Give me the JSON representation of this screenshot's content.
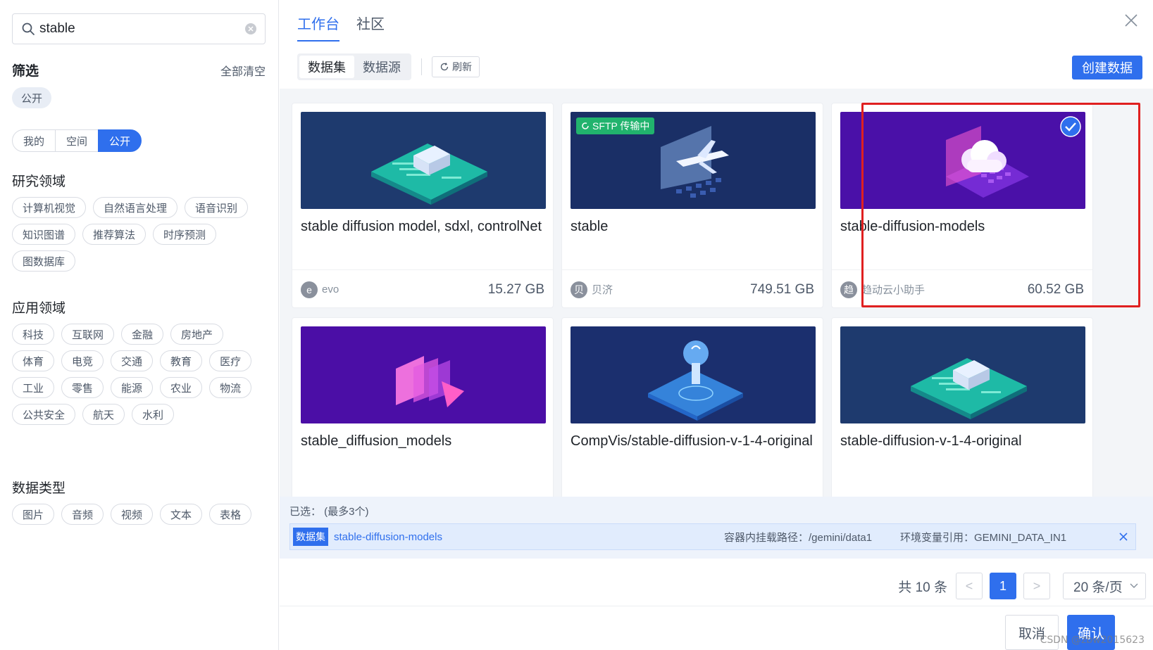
{
  "search": {
    "value": "stable"
  },
  "filter": {
    "title": "筛选",
    "clear_all": "全部清空",
    "active_chip": "公开",
    "scope": [
      "我的",
      "空间",
      "公开"
    ]
  },
  "sections": [
    {
      "title": "研究领域",
      "tags": [
        "计算机视觉",
        "自然语言处理",
        "语音识别",
        "知识图谱",
        "推荐算法",
        "时序预测",
        "图数据库"
      ]
    },
    {
      "title": "应用领域",
      "tags": [
        "科技",
        "互联网",
        "金融",
        "房地产",
        "体育",
        "电竞",
        "交通",
        "教育",
        "医疗",
        "工业",
        "零售",
        "能源",
        "农业",
        "物流",
        "公共安全",
        "航天",
        "水利"
      ]
    },
    {
      "title": "数据类型",
      "tags": [
        "图片",
        "音频",
        "视频",
        "文本",
        "表格"
      ]
    }
  ],
  "tabs": [
    "工作台",
    "社区"
  ],
  "subtabs": [
    "数据集",
    "数据源"
  ],
  "refresh_label": "刷新",
  "create_label": "创建数据",
  "cards": [
    {
      "name": "stable diffusion model, sdxl, controlNet",
      "owner": "evo",
      "avatar": "e",
      "size": "15.27 GB",
      "theme": "teal-truck"
    },
    {
      "name": "stable",
      "owner": "贝济",
      "avatar": "贝",
      "size": "749.51 GB",
      "theme": "plane",
      "badge": "SFTP 传输中"
    },
    {
      "name": "stable-diffusion-models",
      "owner": "趋动云小助手",
      "avatar": "趋",
      "size": "60.52 GB",
      "theme": "cloud",
      "selected": true
    },
    {
      "name": "stable_diffusion_models",
      "theme": "video"
    },
    {
      "name": "CompVis/stable-diffusion-v-1-4-original",
      "theme": "bulb"
    },
    {
      "name": "stable-diffusion-v-1-4-original",
      "theme": "teal-truck"
    }
  ],
  "selected": {
    "label": "已选：  (最多3个)",
    "type": "数据集",
    "name": "stable-diffusion-models",
    "mount_path": "容器内挂载路径：/gemini/data1",
    "env_var": "环境变量引用：GEMINI_DATA_IN1"
  },
  "pagination": {
    "total": "共 10 条",
    "prev": "<",
    "current": "1",
    "next": ">",
    "page_size": "20 条/页"
  },
  "footer": {
    "cancel": "取消",
    "confirm": "确认"
  },
  "watermark": "CSDN @zbw2015623",
  "colors": {
    "accent": "#2f6fed",
    "highlight": "#e02020",
    "badge": "#21b36d"
  }
}
